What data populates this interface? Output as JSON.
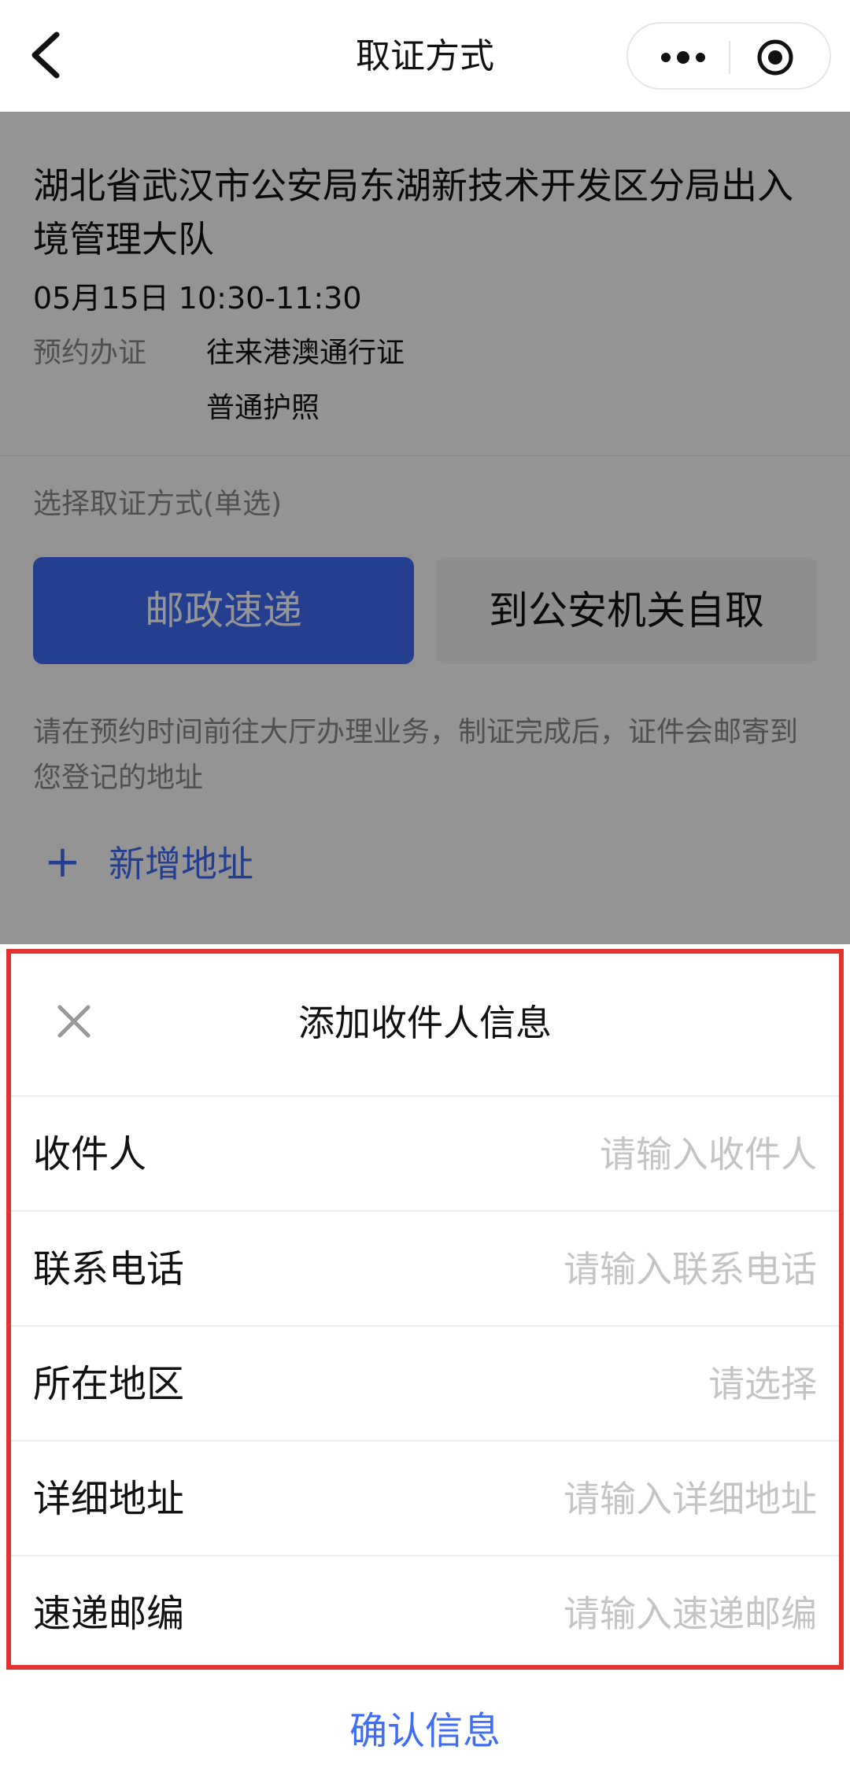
{
  "navbar": {
    "title": "取证方式"
  },
  "appointment": {
    "org_name": "湖北省武汉市公安局东湖新技术开发区分局出入境管理大队",
    "time": "05月15日 10:30-11:30",
    "label": "预约办证",
    "items": [
      "往来港澳通行证",
      "普通护照"
    ]
  },
  "pickup": {
    "title": "选择取证方式(单选)",
    "options": [
      "邮政速递",
      "到公安机关自取"
    ],
    "selected": "邮政速递",
    "note": "请在预约时间前往大厅办理业务，制证完成后，证件会邮寄到您登记的地址"
  },
  "address": {
    "add_label": "新增地址",
    "plus": "+"
  },
  "sheet": {
    "title": "添加收件人信息",
    "fields": [
      {
        "label": "收件人",
        "placeholder": "请输入收件人"
      },
      {
        "label": "联系电话",
        "placeholder": "请输入联系电话"
      },
      {
        "label": "所在地区",
        "placeholder": "请选择"
      },
      {
        "label": "详细地址",
        "placeholder": "请输入详细地址"
      },
      {
        "label": "速递邮编",
        "placeholder": "请输入速递邮编"
      }
    ],
    "confirm_label": "确认信息"
  },
  "colors": {
    "accent": "#3f6df6",
    "highlight_border": "#e3332d",
    "placeholder": "#c4c4c4",
    "muted": "#8a8a8a"
  },
  "icons": [
    "back-arrow-icon",
    "more-dots-icon",
    "target-circle-icon",
    "close-icon",
    "plus-icon"
  ]
}
